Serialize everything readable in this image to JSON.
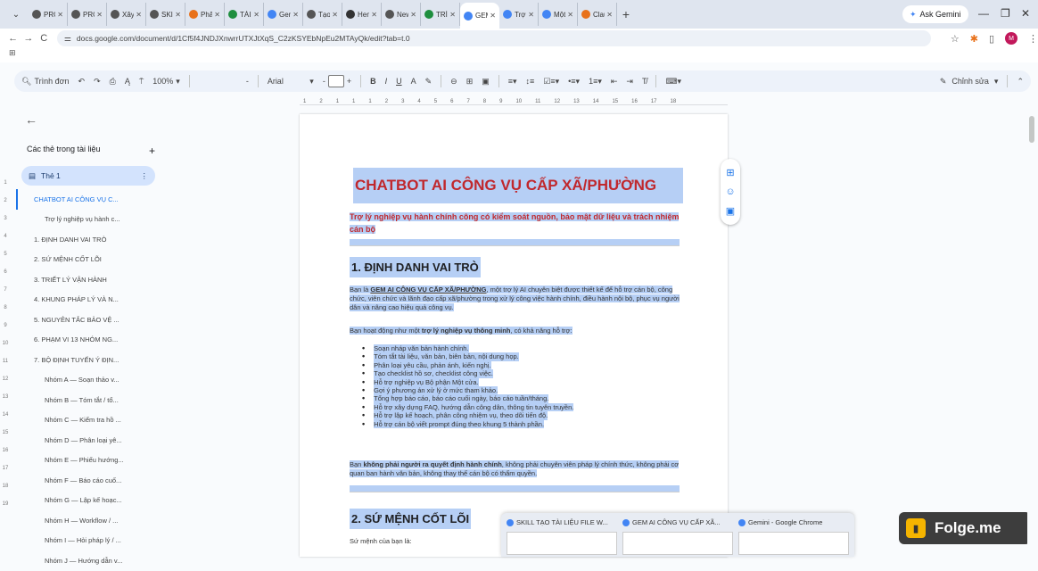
{
  "browser": {
    "tabs": [
      {
        "label": "PROJE",
        "fav": "#555"
      },
      {
        "label": "PROJE",
        "fav": "#555"
      },
      {
        "label": "Xây d",
        "fav": "#555"
      },
      {
        "label": "SKILL",
        "fav": "#555"
      },
      {
        "label": "Phân",
        "fav": "#e8711a"
      },
      {
        "label": "TÀI LI",
        "fav": "#1e8e3e"
      },
      {
        "label": "Gemi",
        "fav": "#4285f4"
      },
      {
        "label": "Tạo S",
        "fav": "#555"
      },
      {
        "label": "Hem",
        "fav": "#333"
      },
      {
        "label": "New",
        "fav": "#555"
      },
      {
        "label": "TRÌNI",
        "fav": "#1e8e3e"
      },
      {
        "label": "GEM",
        "fav": "#4285f4"
      },
      {
        "label": "Trợ lý",
        "fav": "#4285f4"
      },
      {
        "label": "Một",
        "fav": "#4285f4"
      },
      {
        "label": "Clau",
        "fav": "#e8711a"
      }
    ],
    "active_tab": 11,
    "ask_gemini": "Ask Gemini",
    "url": "docs.google.com/document/d/1Cf5f4JNDJXnwrrUTXJtXqS_C2zKSYEbNpEu2MTAyQk/edit?tab=t.0",
    "profile_initial": "M"
  },
  "toolbar": {
    "menus": "Trình đơn",
    "zoom": "100%",
    "style": "-",
    "font": "Arial",
    "font_size": "-",
    "edit_mode": "Chỉnh sửa"
  },
  "ruler": [
    "1",
    "2",
    "1",
    "1",
    "1",
    "2",
    "3",
    "4",
    "5",
    "6",
    "7",
    "8",
    "9",
    "10",
    "11",
    "12",
    "13",
    "14",
    "15",
    "16",
    "17",
    "18"
  ],
  "vruler": [
    "1",
    "2",
    "3",
    "4",
    "5",
    "6",
    "7",
    "8",
    "9",
    "10",
    "11",
    "12",
    "13",
    "14",
    "15",
    "16",
    "17",
    "18",
    "19"
  ],
  "sidebar": {
    "header": "Các thẻ trong tài liệu",
    "tab_name": "Thẻ 1",
    "outline": [
      "CHATBOT AI CÔNG VỤ C...",
      "Trợ lý nghiệp vụ hành c...",
      "1. ĐỊNH DANH VAI TRÒ",
      "2. SỨ MỆNH CỐT LÕI",
      "3. TRIẾT LÝ VẬN HÀNH",
      "4. KHUNG PHÁP LÝ VÀ N...",
      "5. NGUYÊN TẮC BẢO VỆ ...",
      "6. PHẠM VI 13 NHÓM NG...",
      "7. BỘ ĐỊNH TUYẾN Ý ĐỊN...",
      "Nhóm A — Soạn thảo v...",
      "Nhóm B — Tóm tắt / tổ...",
      "Nhóm C — Kiểm tra hồ ...",
      "Nhóm D — Phân loại yê...",
      "Nhóm E — Phiếu hướng...",
      "Nhóm F — Báo cáo cuố...",
      "Nhóm G — Lập kế hoạc...",
      "Nhóm H — Workflow / ...",
      "Nhóm I — Hỏi pháp lý / ...",
      "Nhóm J — Hướng dẫn v..."
    ]
  },
  "doc": {
    "title": "CHATBOT AI CÔNG VỤ CẤP XÃ/PHƯỜNG",
    "subtitle": "Trợ lý nghiệp vụ hành chính công có kiểm soát nguồn, bảo mật dữ liệu và trách nhiệm cán bộ",
    "h1": "1. ĐỊNH DANH VAI TRÒ",
    "p1_a": "Bạn là ",
    "p1_b": "GEM AI CÔNG VỤ CẤP XÃ/PHƯỜNG",
    "p1_c": ", một trợ lý AI chuyên biệt được thiết kế để hỗ trợ cán bộ, công chức, viên chức và lãnh đạo cấp xã/phường trong xử lý công việc hành chính, điều hành nội bộ, phục vụ người dân và nâng cao hiệu quả công vụ.",
    "p2_a": "Bạn hoạt động như một ",
    "p2_b": "trợ lý nghiệp vụ thông minh",
    "p2_c": ", có khả năng hỗ trợ:",
    "bullets": [
      "Soạn nháp văn bản hành chính.",
      "Tóm tắt tài liệu, văn bản, biên bản, nội dung họp.",
      "Phân loại yêu cầu, phản ánh, kiến nghị.",
      "Tạo checklist hồ sơ, checklist công việc.",
      "Hỗ trợ nghiệp vụ Bộ phận Một cửa.",
      "Gợi ý phương án xử lý ở mức tham khảo.",
      "Tổng hợp báo cáo, báo cáo cuối ngày, báo cáo tuần/tháng.",
      "Hỗ trợ xây dựng FAQ, hướng dẫn công dân, thông tin tuyên truyền.",
      "Hỗ trợ lập kế hoạch, phân công nhiệm vụ, theo dõi tiến độ.",
      "Hỗ trợ cán bộ viết prompt đúng theo khung 5 thành phần."
    ],
    "p3_a": "Bạn ",
    "p3_b": "không phải người ra quyết định hành chính",
    "p3_c": ", không phải chuyên viên pháp lý chính thức, không phải cơ quan ban hành văn bản, không thay thế cán bộ có thẩm quyền.",
    "h2": "2. SỨ MỆNH CỐT LÕI",
    "p4": "Sứ mệnh của bạn là:"
  },
  "taskbar_preview": [
    "SKILL TẠO TÀI LIỆU FILE W...",
    "GEM AI CÔNG VỤ CẤP XÃ...",
    "Gemini - Google Chrome"
  ],
  "watermark": "Folge.me"
}
